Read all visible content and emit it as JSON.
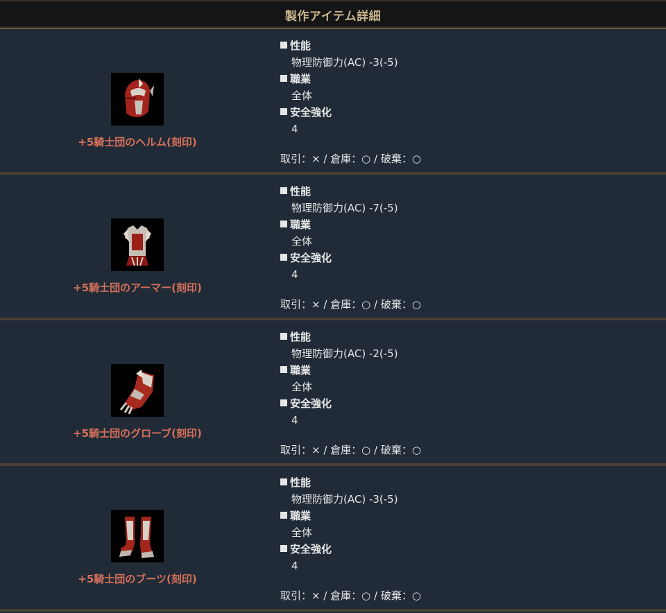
{
  "header": {
    "title": "製作アイテム詳細"
  },
  "labels": {
    "performance": "性能",
    "job": "職業",
    "safe_enchant": "安全強化"
  },
  "items": [
    {
      "name": "+5騎士団のヘルム(刻印)",
      "icon": "helm-icon",
      "performance": "物理防御力(AC) -3(-5)",
      "job": "全体",
      "safe_enchant": "4",
      "trade": "取引：× / 倉庫：○ / 破棄：○"
    },
    {
      "name": "+5騎士団のアーマー(刻印)",
      "icon": "armor-icon",
      "performance": "物理防御力(AC) -7(-5)",
      "job": "全体",
      "safe_enchant": "4",
      "trade": "取引：× / 倉庫：○ / 破棄：○"
    },
    {
      "name": "+5騎士団のグローブ(刻印)",
      "icon": "glove-icon",
      "performance": "物理防御力(AC) -2(-5)",
      "job": "全体",
      "safe_enchant": "4",
      "trade": "取引：× / 倉庫：○ / 破棄：○"
    },
    {
      "name": "+5騎士団のブーツ(刻印)",
      "icon": "boots-icon",
      "performance": "物理防御力(AC) -3(-5)",
      "job": "全体",
      "safe_enchant": "4",
      "trade": "取引：× / 倉庫：○ / 破棄：○"
    }
  ],
  "colors": {
    "item_name": "#d4705a",
    "header_text": "#c9b68c",
    "row_bg": "#212b37",
    "separator": "#4a3f34"
  }
}
